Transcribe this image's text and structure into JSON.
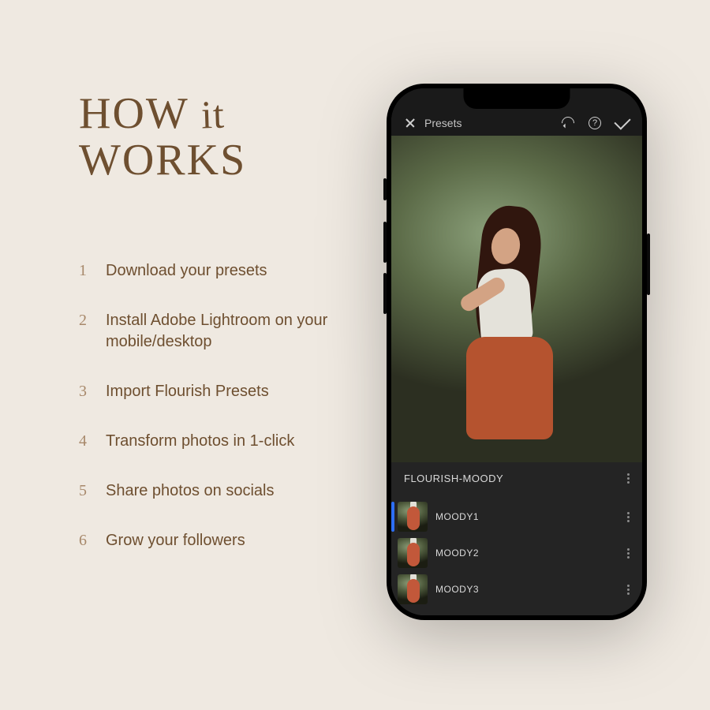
{
  "heading": {
    "line1_a": "HOW",
    "line1_script": "it",
    "line2": "WORKS"
  },
  "steps": [
    {
      "num": "1",
      "text": "Download your presets"
    },
    {
      "num": "2",
      "text": "Install Adobe Lightroom on your mobile/desktop"
    },
    {
      "num": "3",
      "text": "Import Flourish Presets"
    },
    {
      "num": "4",
      "text": "Transform photos in 1-click"
    },
    {
      "num": "5",
      "text": "Share photos on socials"
    },
    {
      "num": "6",
      "text": "Grow your followers"
    }
  ],
  "app": {
    "header": {
      "title": "Presets",
      "help_glyph": "?"
    },
    "preset_group": "FLOURISH-MOODY",
    "presets": [
      {
        "label": "MOODY1",
        "selected": true
      },
      {
        "label": "MOODY2",
        "selected": false
      },
      {
        "label": "MOODY3",
        "selected": false
      }
    ]
  }
}
